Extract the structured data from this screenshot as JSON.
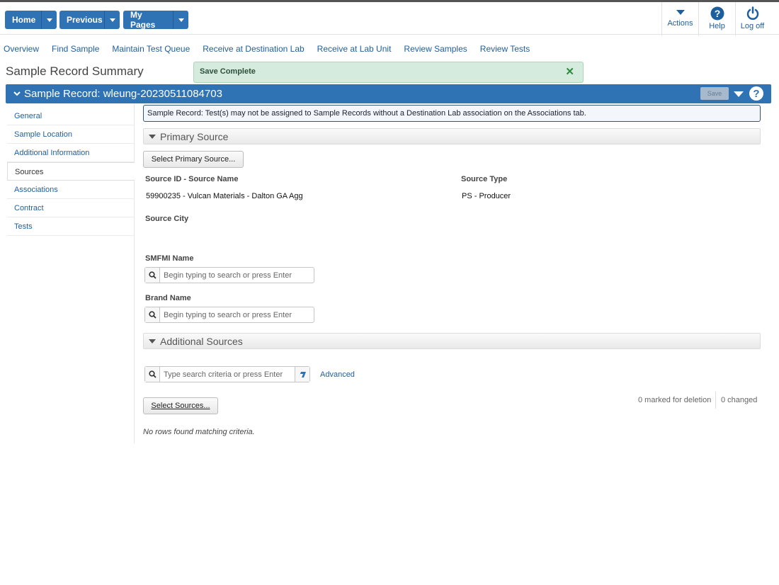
{
  "topbar": {
    "home_label": "Home",
    "previous_label": "Previous",
    "mypages_label": "My Pages",
    "actions_label": "Actions",
    "help_label": "Help",
    "logoff_label": "Log off"
  },
  "nav": {
    "links": [
      "Overview",
      "Find Sample",
      "Maintain Test Queue",
      "Receive at Destination Lab",
      "Receive at Lab Unit",
      "Review Samples",
      "Review Tests"
    ]
  },
  "page": {
    "title": "Sample Record Summary"
  },
  "toast": {
    "message": "Save Complete",
    "close": "✕"
  },
  "record": {
    "title": "Sample Record: wleung-20230511084703",
    "save_label": "Save",
    "help_glyph": "?"
  },
  "sidebar": {
    "items": [
      {
        "label": "General"
      },
      {
        "label": "Sample Location"
      },
      {
        "label": "Additional Information"
      },
      {
        "label": "Sources"
      },
      {
        "label": "Associations"
      },
      {
        "label": "Contract"
      },
      {
        "label": "Tests"
      }
    ],
    "active": "Sources"
  },
  "info": {
    "message": "Sample Record: Test(s) may not be assigned to Sample Records without a Destination Lab association on the Associations tab."
  },
  "primary_source": {
    "section_title": "Primary Source",
    "select_button": "Select Primary Source...",
    "source_id_label": "Source ID - Source Name",
    "source_id_value": "59900235 - Vulcan Materials - Dalton GA Agg",
    "source_type_label": "Source Type",
    "source_type_value": "PS - Producer",
    "source_city_label": "Source City",
    "smfmi_label": "SMFMI Name",
    "smfmi_placeholder": "Begin typing to search or press Enter",
    "brand_label": "Brand Name",
    "brand_placeholder": "Begin typing to search or press Enter"
  },
  "additional_sources": {
    "section_title": "Additional Sources",
    "search_placeholder": "Type search criteria or press Enter",
    "advanced_label": "Advanced",
    "select_button": "Select Sources...",
    "marked_for_deletion": "0 marked for deletion",
    "changed": "0 changed",
    "no_rows": "No rows found matching criteria."
  },
  "colors": {
    "accent": "#2f73b5",
    "link": "#1d5f9e",
    "toast_bg": "#d4ebdd",
    "toast_close": "#2e8b3e"
  }
}
